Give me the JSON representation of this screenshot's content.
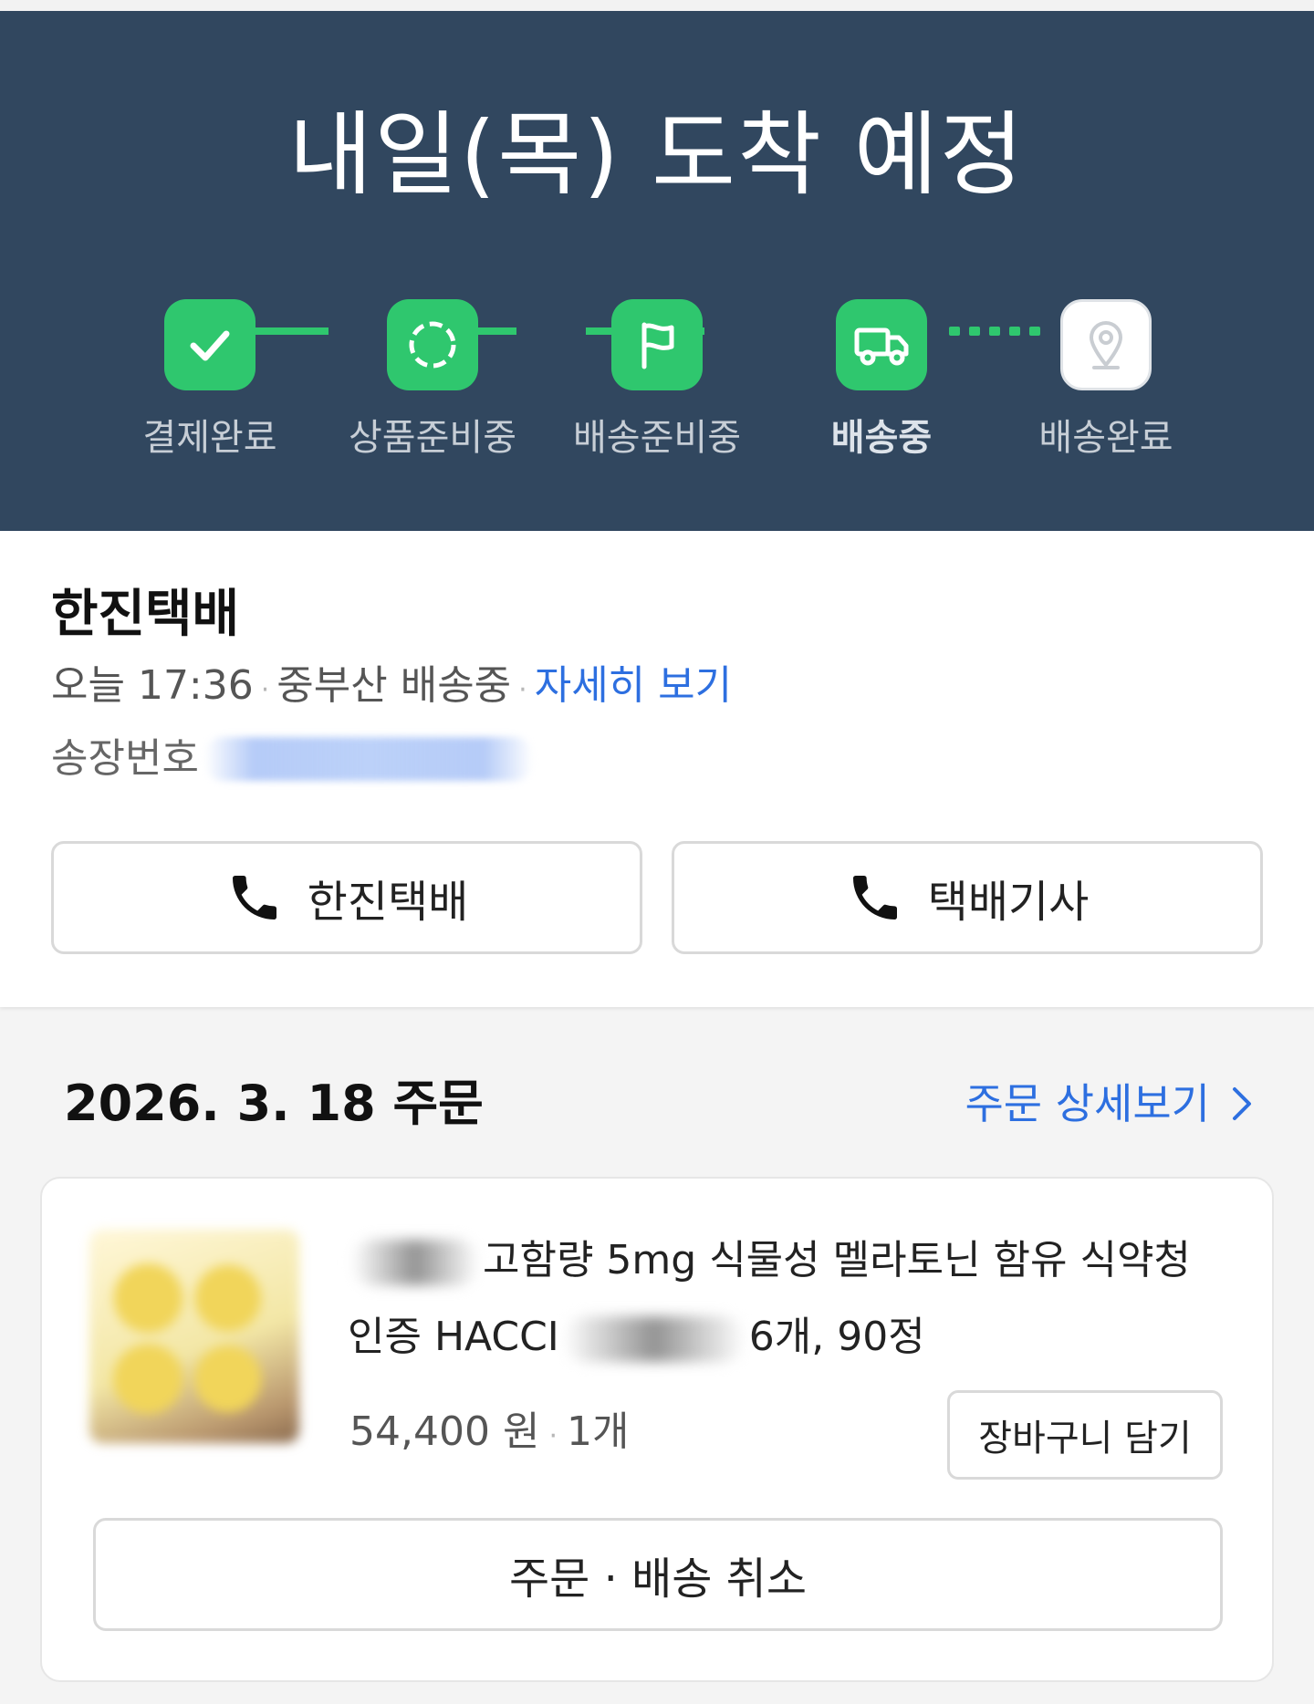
{
  "header": {
    "eta_title": "내일(목) 도착 예정",
    "steps": [
      {
        "label": "결제완료",
        "icon": "check-icon",
        "state": "done"
      },
      {
        "label": "상품준비중",
        "icon": "dashed-circle-icon",
        "state": "done"
      },
      {
        "label": "배송준비중",
        "icon": "flag-icon",
        "state": "done"
      },
      {
        "label": "배송중",
        "icon": "truck-icon",
        "state": "current"
      },
      {
        "label": "배송완료",
        "icon": "location-pin-icon",
        "state": "pending"
      }
    ]
  },
  "courier": {
    "name": "한진택배",
    "time": "오늘 17:36",
    "location_status": "중부산 배송중",
    "detail_link": "자세히 보기",
    "invoice_label": "송장번호",
    "invoice_number": "",
    "call_company_label": "한진택배",
    "call_driver_label": "택배기사"
  },
  "order": {
    "date_title": "2026. 3. 18 주문",
    "detail_link": "주문 상세보기",
    "product": {
      "title_part1": "고함량 5mg 식물성 멜라토닌 함유 식약청",
      "title_part2_prefix": "인증 HACCI",
      "title_part2_suffix": "6개, 90정",
      "price": "54,400 원",
      "quantity": "1개",
      "cart_button": "장바구니 담기"
    },
    "cancel_button": "주문 · 배송 취소"
  },
  "colors": {
    "header_bg": "#31475f",
    "accent_green": "#2fc76e",
    "link_blue": "#2d6fe0"
  }
}
